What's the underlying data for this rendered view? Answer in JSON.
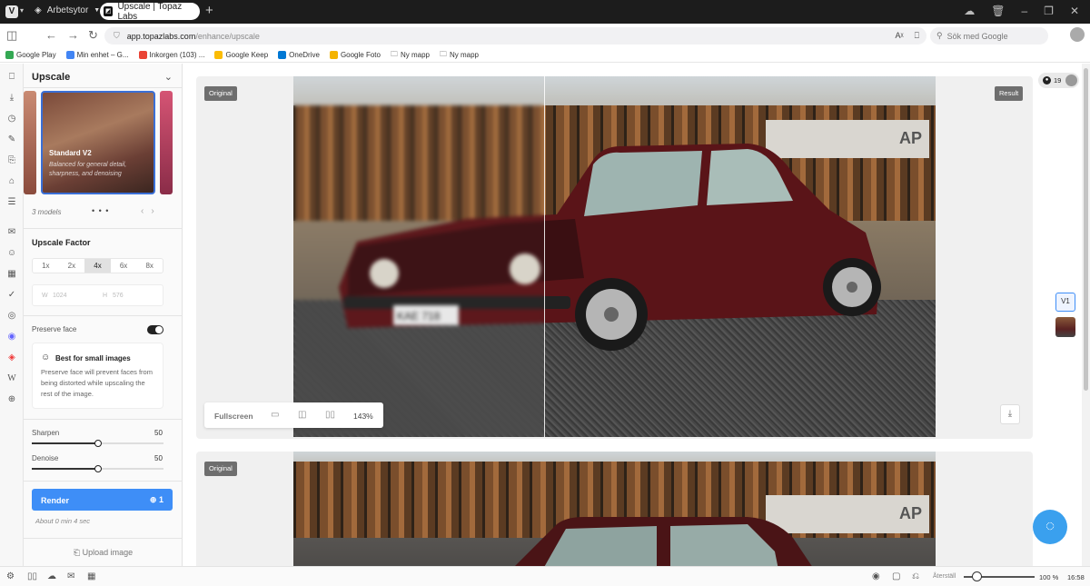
{
  "browser": {
    "workspaces": "Arbetsytor",
    "tab_title": "Upscale | Topaz Labs",
    "url_domain": "app.topazlabs.com",
    "url_path": "/enhance/upscale",
    "search_placeholder": "Sök med Google"
  },
  "bookmarks": [
    {
      "label": "Google Play",
      "color": "#34a853"
    },
    {
      "label": "Min enhet – G...",
      "color": "#4285f4"
    },
    {
      "label": "Inkorgen (103) ...",
      "color": "#ea4335"
    },
    {
      "label": "Google Keep",
      "color": "#fbbc04"
    },
    {
      "label": "OneDrive",
      "color": "#0078d4"
    },
    {
      "label": "Google Foto",
      "color": "#f4b400"
    },
    {
      "label": "Ny mapp",
      "color": "#888888"
    },
    {
      "label": "Ny mapp",
      "color": "#888888"
    }
  ],
  "panel": {
    "title": "Upscale",
    "model": {
      "name": "Standard V2",
      "description": "Balanced for general detail, sharpness, and denoising"
    },
    "models_count": "3 models",
    "dots": "• • •",
    "upscale_factor_title": "Upscale Factor",
    "factors": [
      "1x",
      "2x",
      "4x",
      "6x",
      "8x"
    ],
    "selected_factor": "4x",
    "width_label": "W",
    "width_value": "1024",
    "height_label": "H",
    "height_value": "576",
    "preserve_face_label": "Preserve face",
    "preserve_face_on": true,
    "info_title": "Best for small images",
    "info_body": "Preserve face will prevent faces from being distorted while upscaling the rest of the image.",
    "sharpen_label": "Sharpen",
    "sharpen_value": "50",
    "denoise_label": "Denoise",
    "denoise_value": "50",
    "render_label": "Render",
    "render_credits": "1",
    "render_estimate": "About 0 min 4 sec",
    "upload_label": "Upload image"
  },
  "viewer": {
    "original_badge": "Original",
    "result_badge": "Result",
    "fullscreen_label": "Fullscreen",
    "zoom": "143%",
    "plate_text": "KAE 718",
    "sign_text": "AP"
  },
  "right_rail": {
    "credits": "19",
    "version": "V1"
  },
  "statusbar": {
    "reset_label": "Återställ",
    "zoom": "100 %",
    "time": "16:58",
    "zoom_fraction": 0.2
  },
  "colors": {
    "accent": "#3e8ef7",
    "chat": "#3aa0ee"
  }
}
